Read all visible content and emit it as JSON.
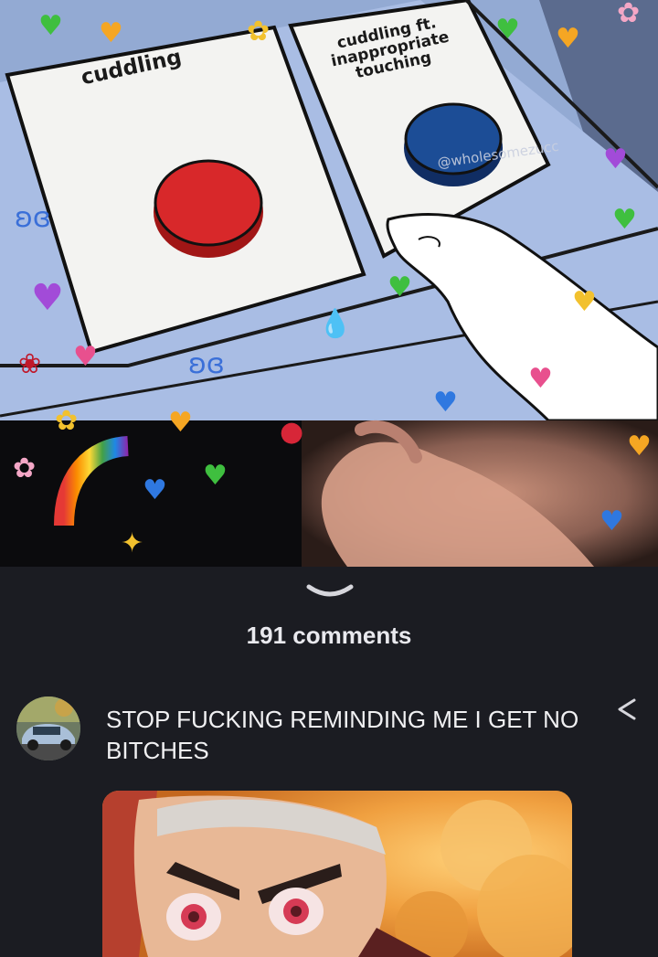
{
  "meme": {
    "button_left_label": "cuddling",
    "button_right_label": "cuddling ft. inappropriate touching",
    "watermark": "@wholesomezucc",
    "colors": {
      "panel_bg": "#8da4cf",
      "red_button": "#d8282a",
      "blue_button": "#1c4d96"
    }
  },
  "comments": {
    "count_label": "191 comments",
    "toggle_icon": "chevron-down-icon"
  },
  "comment": {
    "text": "STOP FUCKING REMINDING ME I GET NO BITCHES",
    "share_icon": "share-icon",
    "avatar_icon": "car-avatar"
  }
}
